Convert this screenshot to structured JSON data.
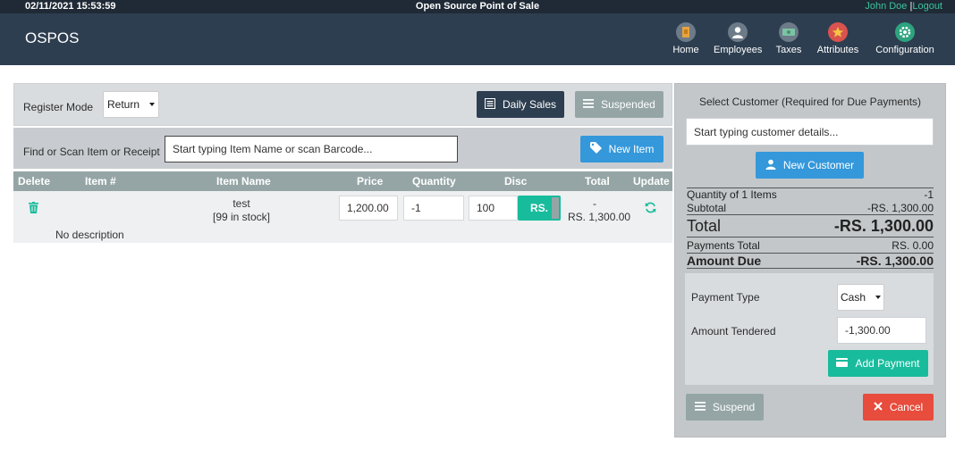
{
  "topbar": {
    "datetime": "02/11/2021 15:53:59",
    "app_title": "Open Source Point of Sale",
    "user": "John Doe",
    "separator": "|",
    "logout": "Logout"
  },
  "navbar": {
    "brand": "OSPOS",
    "items": [
      {
        "label": "Home",
        "icon": "home-icon",
        "color": "#7a8794"
      },
      {
        "label": "Employees",
        "icon": "employees-icon",
        "color": "#6d7a88"
      },
      {
        "label": "Taxes",
        "icon": "taxes-icon",
        "color": "#6d7a88"
      },
      {
        "label": "Attributes",
        "icon": "attributes-icon",
        "color": "#d9534f"
      },
      {
        "label": "Configuration",
        "icon": "configuration-icon",
        "color": "#2ea37f"
      }
    ]
  },
  "register": {
    "mode_label": "Register Mode",
    "mode_value": "Return",
    "daily_sales": "Daily Sales",
    "suspended": "Suspended"
  },
  "find": {
    "label": "Find or Scan Item or Receipt",
    "placeholder": "Start typing Item Name or scan Barcode...",
    "new_item": "New Item"
  },
  "cart": {
    "columns": [
      "Delete",
      "Item #",
      "Item Name",
      "Price",
      "Quantity",
      "Disc",
      "Total",
      "Update"
    ],
    "rows": [
      {
        "item_number": "",
        "name": "test",
        "stock": "[99 in stock]",
        "price": "1,200.00",
        "quantity": "-1",
        "discount": "100",
        "discount_type": "RS.",
        "total_dash": "-",
        "total": "RS. 1,300.00",
        "description": "No description"
      }
    ]
  },
  "customer": {
    "title": "Select Customer (Required for Due Payments)",
    "placeholder": "Start typing customer details...",
    "new_customer": "New Customer"
  },
  "summary": {
    "quantity_label": "Quantity of 1 Items",
    "quantity_value": "-1",
    "subtotal_label": "Subtotal",
    "subtotal_value": "-RS. 1,300.00",
    "total_label": "Total",
    "total_value": "-RS. 1,300.00",
    "payments_total_label": "Payments Total",
    "payments_total_value": "RS. 0.00",
    "amount_due_label": "Amount Due",
    "amount_due_value": "-RS. 1,300.00"
  },
  "payment": {
    "type_label": "Payment Type",
    "type_value": "Cash",
    "tendered_label": "Amount Tendered",
    "tendered_value": "-1,300.00",
    "add_payment": "Add Payment"
  },
  "actions": {
    "suspend": "Suspend",
    "cancel": "Cancel"
  },
  "colors": {
    "navbar": "#2d3e50",
    "teal": "#18bc9c",
    "blue": "#3498db",
    "red": "#e74c3c",
    "grey": "#95a5a6"
  }
}
